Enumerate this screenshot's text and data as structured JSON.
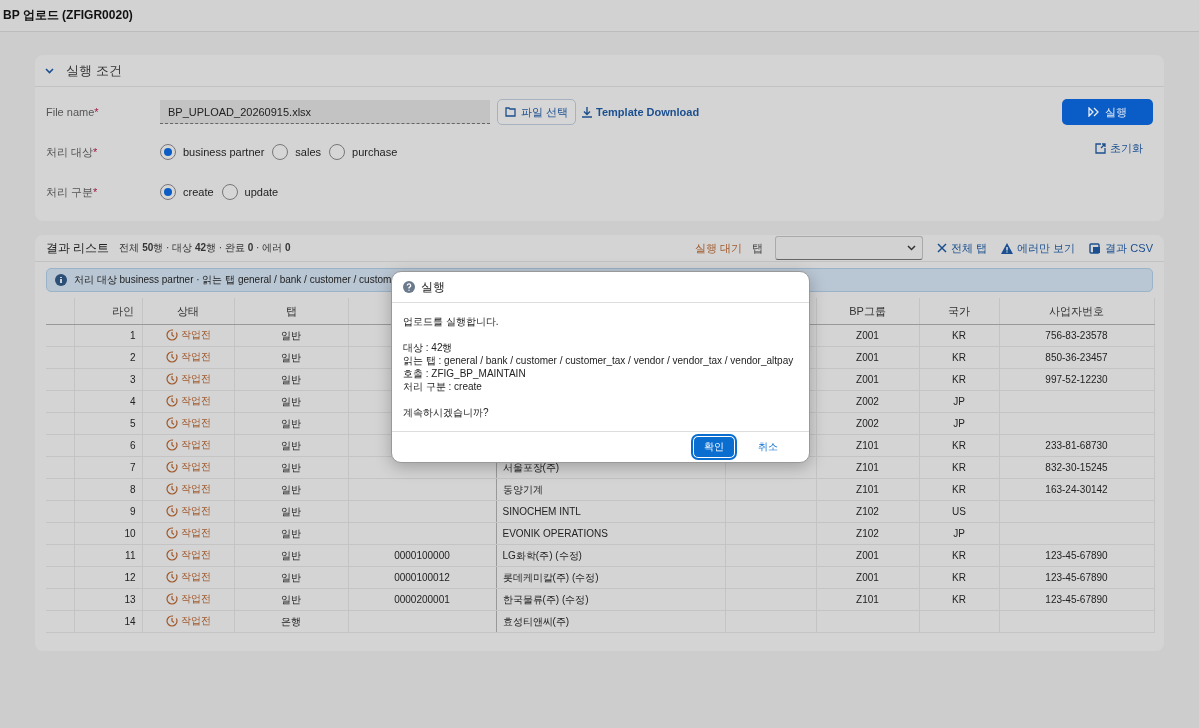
{
  "page": {
    "title": "BP 업로드 (ZFIGR0020)"
  },
  "conditions": {
    "title": "실행 조건",
    "expanded": true,
    "file": {
      "label": "File name",
      "required_mark": "*",
      "value": "BP_UPLOAD_20260915.xlsx",
      "browse": "파일 선택",
      "template": "Template Download"
    },
    "groups": [
      {
        "label": "처리 대상",
        "required_mark": "*",
        "options": [
          {
            "label": "business partner",
            "selected": true
          },
          {
            "label": "sales",
            "selected": false
          },
          {
            "label": "purchase",
            "selected": false
          }
        ]
      },
      {
        "label": "처리 구분",
        "required_mark": "*",
        "options": [
          {
            "label": "create",
            "selected": true
          },
          {
            "label": "update",
            "selected": false
          }
        ]
      }
    ],
    "run_button": "실행",
    "reset_button": "초기화"
  },
  "results": {
    "title": "결과 리스트",
    "summary": "전체 **50**행 · 대상 **42**행 · 완료 **0** · 에러 **0**",
    "status": "실행 대기",
    "tab_label": "탭",
    "tab_select": {
      "kind": "dropdown"
    },
    "actions": [
      {
        "kind": "clear",
        "label": "전체 탭"
      },
      {
        "kind": "errors",
        "label": "에러만 보기"
      },
      {
        "kind": "csv",
        "label": "결과 CSV"
      }
    ],
    "info": "처리 대상 business partner · 읽는 탭 general / bank / customer / custom",
    "table": {
      "columns": [
        "",
        "라인",
        "상태",
        "탭",
        "",
        "",
        "",
        "BP그룹",
        "국가",
        "사업자번호"
      ],
      "rows": [
        {
          "cells": [
            "",
            "1",
            "작업전",
            "일반",
            "",
            "",
            "",
            "Z001",
            "KR",
            "756-83-23578"
          ]
        },
        {
          "cells": [
            "",
            "2",
            "작업전",
            "일반",
            "",
            "",
            "",
            "Z001",
            "KR",
            "850-36-23457"
          ]
        },
        {
          "cells": [
            "",
            "3",
            "작업전",
            "일반",
            "",
            "",
            "",
            "Z001",
            "KR",
            "997-52-12230"
          ]
        },
        {
          "cells": [
            "",
            "4",
            "작업전",
            "일반",
            "",
            "",
            "",
            "Z002",
            "JP",
            ""
          ]
        },
        {
          "cells": [
            "",
            "5",
            "작업전",
            "일반",
            "",
            "",
            "",
            "Z002",
            "JP",
            ""
          ]
        },
        {
          "cells": [
            "",
            "6",
            "작업전",
            "일반",
            "",
            "",
            "",
            "Z101",
            "KR",
            "233-81-68730"
          ]
        },
        {
          "cells": [
            "",
            "7",
            "작업전",
            "일반",
            "",
            "서울포장(주)",
            "",
            "Z101",
            "KR",
            "832-30-15245"
          ]
        },
        {
          "cells": [
            "",
            "8",
            "작업전",
            "일반",
            "",
            "동양기계",
            "",
            "Z101",
            "KR",
            "163-24-30142"
          ]
        },
        {
          "cells": [
            "",
            "9",
            "작업전",
            "일반",
            "",
            "SINOCHEM INTL",
            "",
            "Z102",
            "US",
            ""
          ]
        },
        {
          "cells": [
            "",
            "10",
            "작업전",
            "일반",
            "",
            "EVONIK OPERATIONS",
            "",
            "Z102",
            "JP",
            ""
          ]
        },
        {
          "cells": [
            "",
            "11",
            "작업전",
            "일반",
            "0000100000",
            "LG화학(주) (수정)",
            "",
            "Z001",
            "KR",
            "123-45-67890"
          ]
        },
        {
          "cells": [
            "",
            "12",
            "작업전",
            "일반",
            "0000100012",
            "롯데케미칼(주) (수정)",
            "",
            "Z001",
            "KR",
            "123-45-67890"
          ]
        },
        {
          "cells": [
            "",
            "13",
            "작업전",
            "일반",
            "0000200001",
            "한국물류(주) (수정)",
            "",
            "Z101",
            "KR",
            "123-45-67890"
          ]
        },
        {
          "cells": [
            "",
            "14",
            "작업전",
            "은행",
            "",
            "효성티앤씨(주)",
            "",
            "",
            "",
            ""
          ]
        }
      ]
    }
  },
  "dialog": {
    "title": "실행",
    "paragraphs": [
      [
        "업로드를 실행합니다."
      ],
      [
        "대상 : 42행",
        "읽는 탭 : general / bank / customer / customer_tax / vendor / vendor_tax / vendor_altpay",
        "호출 : ZFIG_BP_MAINTAIN",
        "처리 구분 : create"
      ],
      [
        "계속하시겠습니까?"
      ]
    ],
    "buttons": [
      {
        "label": "확인",
        "kind": "primary"
      },
      {
        "label": "취소",
        "kind": "text"
      }
    ]
  }
}
